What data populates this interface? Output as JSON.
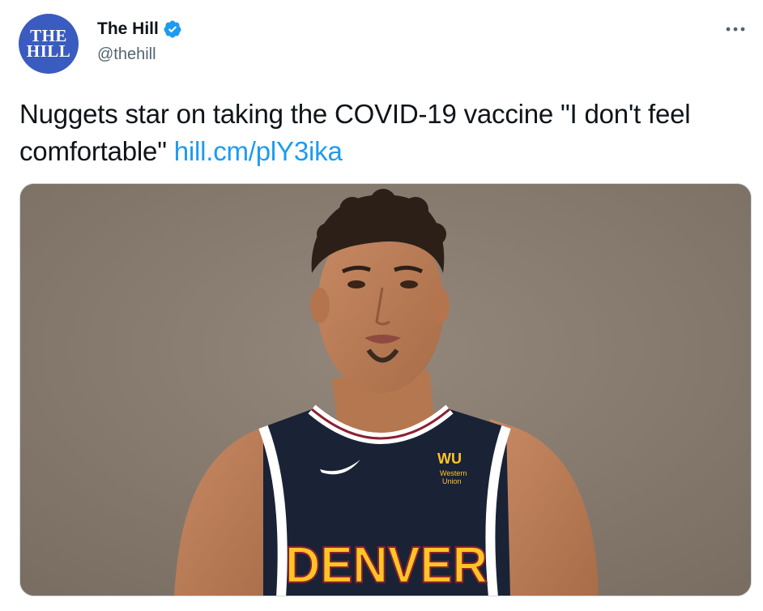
{
  "tweet": {
    "author": {
      "avatar_line1": "THE",
      "avatar_line2": "HILL",
      "display_name": "The Hill",
      "handle": "@thehill",
      "verified": true
    },
    "more_label": "•••",
    "text": "Nuggets star on taking the COVID-19 vaccine \"I don't feel comfortable\" ",
    "link_text": "hill.cm/plY3ika",
    "media": {
      "alt": "Basketball player in Denver Nuggets jersey",
      "jersey_text": "DENVER",
      "sponsor_logo": "WU",
      "sponsor_name_line1": "Western",
      "sponsor_name_line2": "Union"
    }
  },
  "colors": {
    "text": "#0f1419",
    "secondary": "#536471",
    "link": "#1d9bf0",
    "verified": "#1d9bf0",
    "avatar_bg": "#3a5bbf",
    "photo_bg": "#867a6f",
    "jersey_navy": "#1a2236",
    "jersey_yellow": "#fec524"
  }
}
